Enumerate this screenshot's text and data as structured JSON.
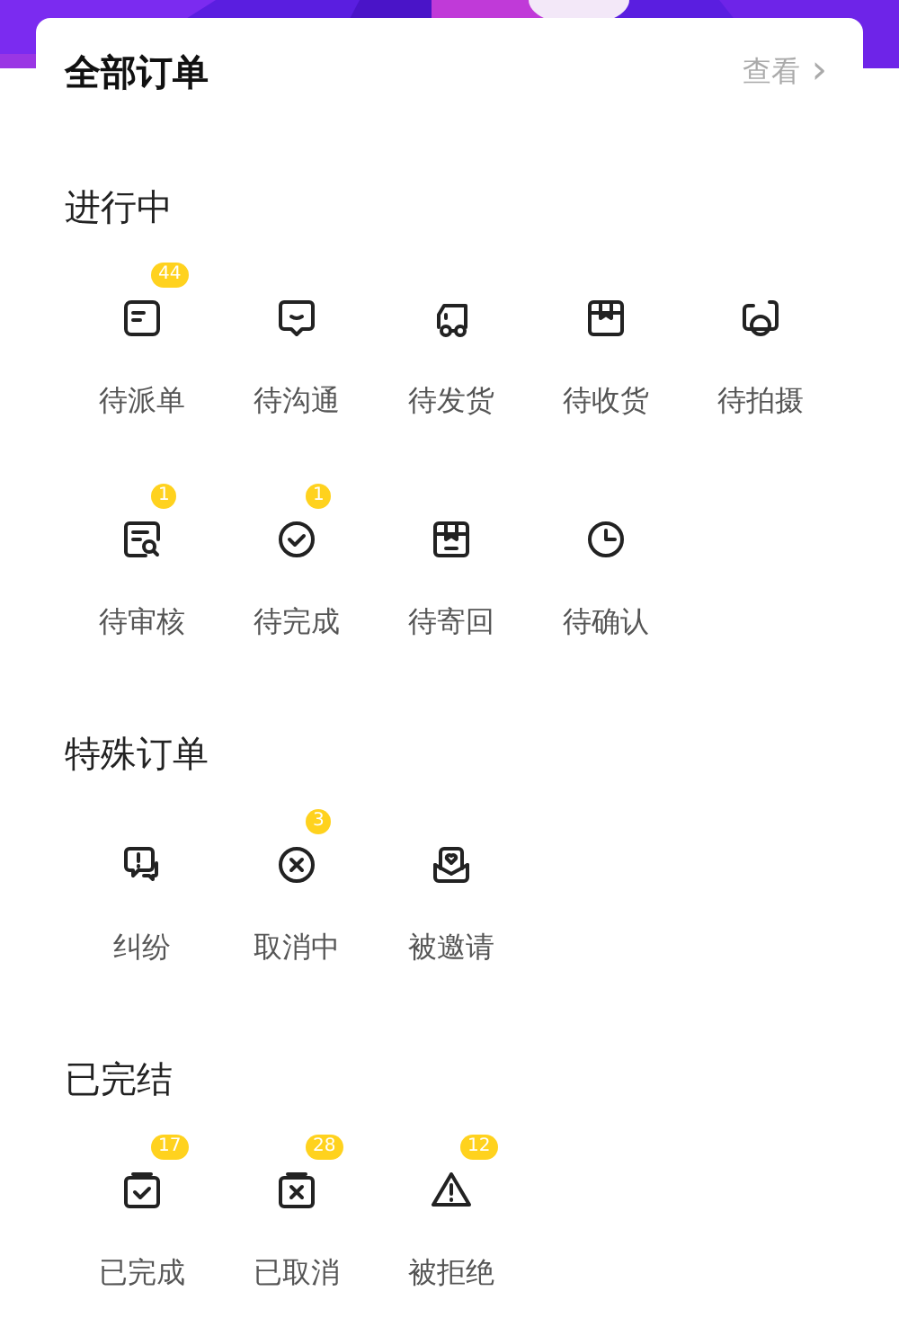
{
  "header": {
    "title": "全部订单",
    "link": "查看",
    "link_arrow": "›"
  },
  "sections": [
    {
      "heading": "进行中",
      "items": [
        {
          "label": "待派单",
          "badge": "44"
        },
        {
          "label": "待沟通"
        },
        {
          "label": "待发货"
        },
        {
          "label": "待收货"
        },
        {
          "label": "待拍摄"
        },
        {
          "label": "待审核",
          "badge": "1"
        },
        {
          "label": "待完成",
          "badge": "1"
        },
        {
          "label": "待寄回"
        },
        {
          "label": "待确认"
        }
      ]
    },
    {
      "heading": "特殊订单",
      "items": [
        {
          "label": "纠纷"
        },
        {
          "label": "取消中",
          "badge": "3"
        },
        {
          "label": "被邀请"
        }
      ]
    },
    {
      "heading": "已完结",
      "items": [
        {
          "label": "已完成",
          "badge": "17"
        },
        {
          "label": "已取消",
          "badge": "28"
        },
        {
          "label": "被拒绝",
          "badge": "12"
        }
      ]
    }
  ]
}
